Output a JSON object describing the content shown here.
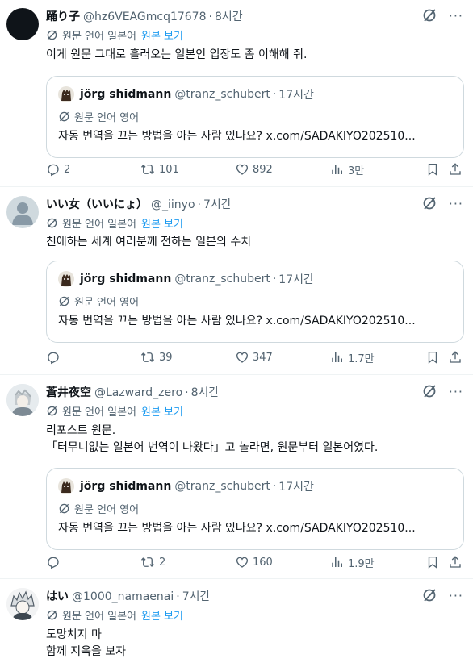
{
  "quote": {
    "name": "jörg shidmann",
    "handle": "@tranz_schubert",
    "time": "17시간",
    "translate_label": "원문 언어 영어",
    "text": "자동 번역을 끄는 방법을 아는 사람 있나요? x.com/SADAKIYO202510..."
  },
  "posts": [
    {
      "name": "踊り子",
      "handle": "@hz6VEAGmcq17678",
      "time": "8시간",
      "translate_label": "원문 언어 일본어",
      "show_original": "원본 보기",
      "text": "이게 원문 그대로 흘러오는 일본인 입장도 좀 이해해 줘.",
      "replies": "2",
      "reposts": "101",
      "likes": "892",
      "views": "3만"
    },
    {
      "name": "いい女（いいにょ）",
      "handle": "@_iinyo",
      "time": "7시간",
      "translate_label": "원문 언어 일본어",
      "show_original": "원본 보기",
      "text": "친애하는 세계 여러분께 전하는 일본의 수치",
      "replies": "",
      "reposts": "39",
      "likes": "347",
      "views": "1.7만"
    },
    {
      "name": "蒼井夜空",
      "handle": "@Lazward_zero",
      "time": "8시간",
      "translate_label": "원문 언어 일본어",
      "show_original": "원본 보기",
      "text": "리포스트 원문.\n「터무니없는 일본어 번역이 나왔다」고 놀라면, 원문부터 일본어였다.",
      "replies": "",
      "reposts": "2",
      "likes": "160",
      "views": "1.9만"
    },
    {
      "name": "はい",
      "handle": "@1000_namaenai",
      "time": "7시간",
      "translate_label": "원문 언어 일본어",
      "show_original": "원본 보기",
      "text": "도망치지 마\n함께 지옥을 보자"
    }
  ],
  "icons": {
    "more": "more-horizontal-icon",
    "grok": "grok-icon",
    "translate": "translate-icon",
    "reply": "reply-icon",
    "repost": "repost-icon",
    "like": "like-icon",
    "views": "views-icon",
    "bookmark": "bookmark-icon",
    "share": "share-icon"
  },
  "colors": {
    "link": "#1d9bf0",
    "secondary": "#536471",
    "border": "#cfd9de",
    "text": "#0f1419"
  }
}
